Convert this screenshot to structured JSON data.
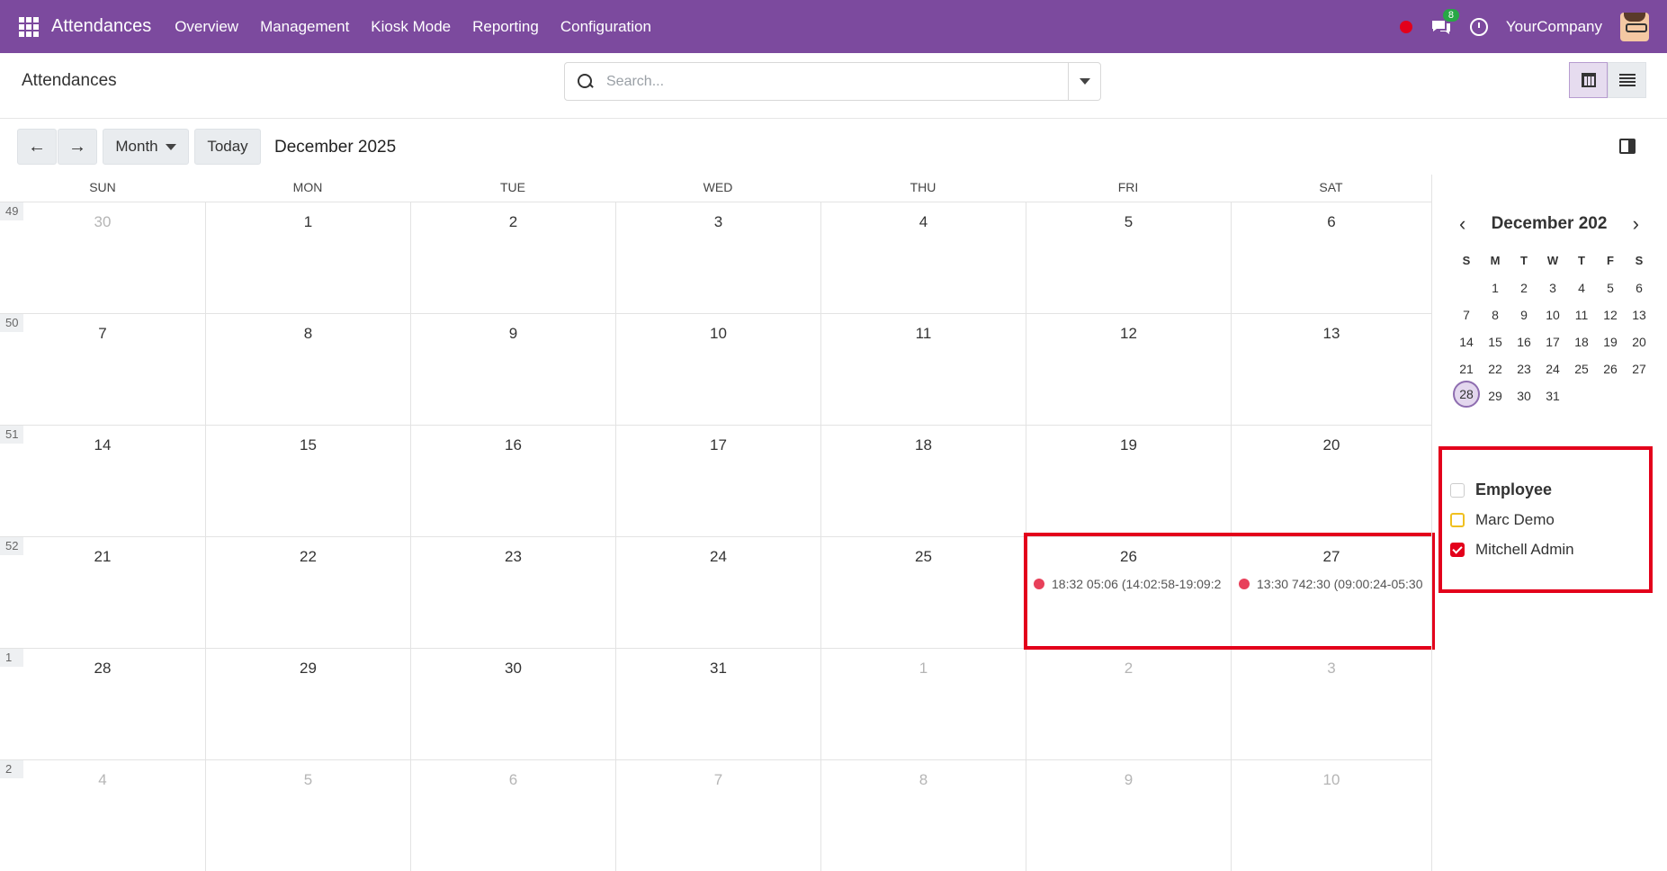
{
  "navbar": {
    "brand": "Attendances",
    "menu": [
      "Overview",
      "Management",
      "Kiosk Mode",
      "Reporting",
      "Configuration"
    ],
    "chat_badge": "8",
    "company": "YourCompany"
  },
  "control": {
    "title": "Attendances",
    "search_placeholder": "Search..."
  },
  "toolbar": {
    "prev": "←",
    "next": "→",
    "scale": "Month",
    "today": "Today",
    "period": "December 2025"
  },
  "calendar": {
    "days": [
      "SUN",
      "MON",
      "TUE",
      "WED",
      "THU",
      "FRI",
      "SAT"
    ],
    "weeks": [
      {
        "num": "49",
        "dates": [
          "30",
          "1",
          "2",
          "3",
          "4",
          "5",
          "6"
        ],
        "muted": [
          0
        ]
      },
      {
        "num": "50",
        "dates": [
          "7",
          "8",
          "9",
          "10",
          "11",
          "12",
          "13"
        ],
        "muted": []
      },
      {
        "num": "51",
        "dates": [
          "14",
          "15",
          "16",
          "17",
          "18",
          "19",
          "20"
        ],
        "muted": []
      },
      {
        "num": "52",
        "dates": [
          "21",
          "22",
          "23",
          "24",
          "25",
          "26",
          "27"
        ],
        "muted": []
      },
      {
        "num": "1",
        "dates": [
          "28",
          "29",
          "30",
          "31",
          "1",
          "2",
          "3"
        ],
        "muted": [
          4,
          5,
          6
        ]
      },
      {
        "num": "2",
        "dates": [
          "4",
          "5",
          "6",
          "7",
          "8",
          "9",
          "10"
        ],
        "muted": [
          0,
          1,
          2,
          3,
          4,
          5,
          6
        ]
      }
    ],
    "events": [
      {
        "week": 3,
        "day": 5,
        "text": "18:32  05:06 (14:02:58-19:09:2",
        "color": "#e8405a"
      },
      {
        "week": 3,
        "day": 6,
        "text": "13:30  742:30 (09:00:24-05:30",
        "color": "#e8405a"
      }
    ]
  },
  "sidebar": {
    "mini_title": "December 202",
    "mini_dow": [
      "S",
      "M",
      "T",
      "W",
      "T",
      "F",
      "S"
    ],
    "mini_dates": [
      "",
      "1",
      "2",
      "3",
      "4",
      "5",
      "6",
      "7",
      "8",
      "9",
      "10",
      "11",
      "12",
      "13",
      "14",
      "15",
      "16",
      "17",
      "18",
      "19",
      "20",
      "21",
      "22",
      "23",
      "24",
      "25",
      "26",
      "27",
      "28",
      "29",
      "30",
      "31"
    ],
    "today": "28",
    "filter_title": "Employee",
    "filters": [
      "Marc Demo",
      "Mitchell Admin"
    ]
  },
  "colors": {
    "navbar": "#7c4a9e",
    "event": "#e8405a",
    "highlight": "#e3001b"
  }
}
